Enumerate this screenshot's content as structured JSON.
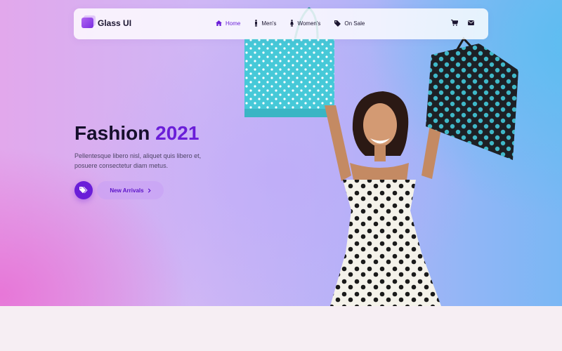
{
  "brand": {
    "name": "Glass UI"
  },
  "nav": {
    "items": [
      {
        "label": "Home",
        "icon": "home-icon",
        "active": true
      },
      {
        "label": "Men's",
        "icon": "male-icon",
        "active": false
      },
      {
        "label": "Women's",
        "icon": "female-icon",
        "active": false
      },
      {
        "label": "On Sale",
        "icon": "tag-icon",
        "active": false
      }
    ],
    "actions": [
      "cart-icon",
      "envelope-icon"
    ]
  },
  "hero": {
    "title_main": "Fashion",
    "title_year": "2021",
    "description": "Pellentesque libero nisl, aliquet quis libero et, posuere consectetur diam metus.",
    "cta_label": "New Arrivals",
    "cta_icon": "chevron-right-icon",
    "tag_button_icon": "tags-icon"
  },
  "colors": {
    "accent": "#6a1ed8",
    "text_dark": "#160f2c",
    "bag_teal": "#44c7d6"
  }
}
